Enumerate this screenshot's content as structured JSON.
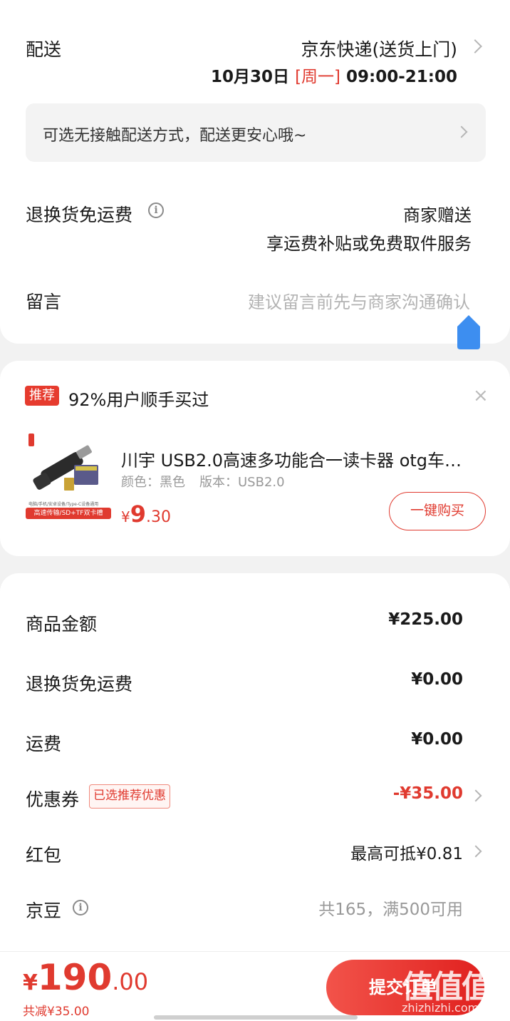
{
  "delivery": {
    "label": "配送",
    "method": "京东快递(送货上门)",
    "date": "10月30日",
    "weekday": "[周一]",
    "time_range": "09:00-21:00",
    "contactless_text": "可选无接触配送方式，配送更安心哦~"
  },
  "return_shipping": {
    "label": "退换货免运费",
    "value": "商家赠送",
    "subtext": "享运费补贴或免费取件服务"
  },
  "message": {
    "label": "留言",
    "placeholder": "建议留言前先与商家沟通确认"
  },
  "recommend": {
    "tag": "推荐",
    "title": "92%用户顺手买过",
    "close_symbol": "×",
    "product_name": "川宇 USB2.0高速多功能合一读卡器 otg车…",
    "spec_color": "颜色：黑色",
    "spec_version": "版本：USB2.0",
    "price_symbol": "¥",
    "price_int": "9",
    "price_dec": ".30",
    "img_caption_small": "电脑/手机/安卓设备/Type-C设备通用",
    "img_caption_banner": "高速传输/SD+TF双卡槽",
    "buy_button": "一键购买"
  },
  "summary": {
    "rows": [
      {
        "label": "商品金额",
        "value": "¥225.00"
      },
      {
        "label": "退换货免运费",
        "value": "¥0.00"
      },
      {
        "label": "运费",
        "value": "¥0.00"
      }
    ],
    "coupon": {
      "label": "优惠券",
      "tag": "已选推荐优惠",
      "value": "-¥35.00"
    },
    "redpacket": {
      "label": "红包",
      "value": "最高可抵¥0.81"
    },
    "jingdou": {
      "label": "京豆",
      "value": "共165，满500可用"
    }
  },
  "bottom": {
    "price_symbol": "¥",
    "price_int": "190",
    "price_dec": ".00",
    "discount_note": "共减¥35.00",
    "submit_button": "提交订单"
  },
  "watermark": {
    "logo": "值值值",
    "url": "zhizhizhi.com"
  },
  "colors": {
    "accent": "#e03a2f",
    "upload_icon": "#3d8ef0"
  }
}
